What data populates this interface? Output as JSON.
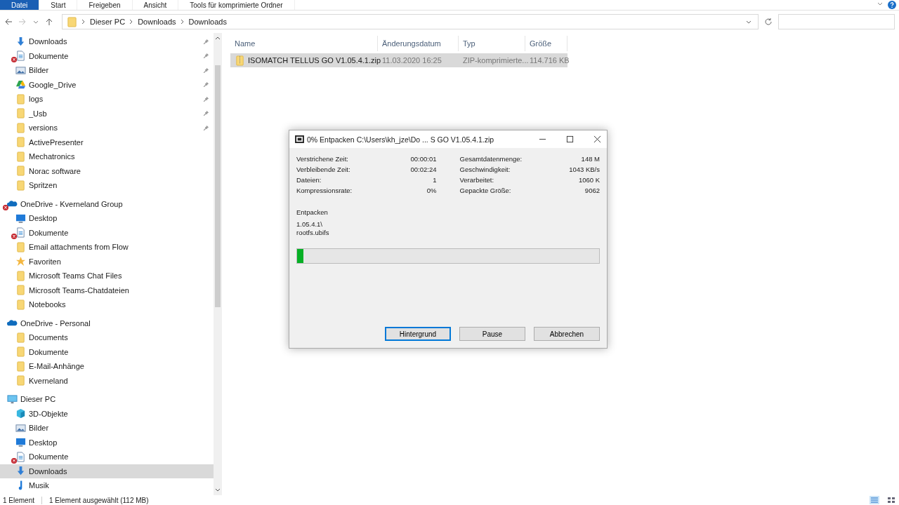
{
  "ribbon": {
    "tabs": [
      {
        "label": "Datei",
        "selected": true
      },
      {
        "label": "Start",
        "selected": false
      },
      {
        "label": "Freigeben",
        "selected": false
      },
      {
        "label": "Ansicht",
        "selected": false
      },
      {
        "label": "Tools für komprimierte Ordner",
        "selected": false
      }
    ]
  },
  "address_bar": {
    "path": [
      "Dieser PC",
      "Downloads",
      "Downloads"
    ]
  },
  "navigation": [
    {
      "label": "Downloads",
      "kind": "download",
      "pinned": true,
      "error": false,
      "selected": false
    },
    {
      "label": "Dokumente",
      "kind": "document",
      "pinned": true,
      "error": true,
      "selected": false
    },
    {
      "label": "Bilder",
      "kind": "picture",
      "pinned": true,
      "error": false,
      "selected": false
    },
    {
      "label": "Google_Drive",
      "kind": "drive",
      "pinned": true,
      "error": false,
      "selected": false
    },
    {
      "label": "logs",
      "kind": "folder",
      "pinned": true,
      "error": false,
      "selected": false
    },
    {
      "label": "_Usb",
      "kind": "folder",
      "pinned": true,
      "error": false,
      "selected": false
    },
    {
      "label": "versions",
      "kind": "folder",
      "pinned": true,
      "error": false,
      "selected": false
    },
    {
      "label": "ActivePresenter",
      "kind": "folder",
      "pinned": false,
      "error": false,
      "selected": false
    },
    {
      "label": "Mechatronics",
      "kind": "folder",
      "pinned": false,
      "error": false,
      "selected": false
    },
    {
      "label": "Norac software",
      "kind": "folder",
      "pinned": false,
      "error": false,
      "selected": false
    },
    {
      "label": "Spritzen",
      "kind": "folder",
      "pinned": false,
      "error": false,
      "selected": false
    },
    {
      "label": "OneDrive - Kverneland Group",
      "kind": "cloud",
      "pinned": false,
      "error": true,
      "selected": false,
      "children": [
        {
          "label": "Desktop",
          "kind": "desktop",
          "pinned": false,
          "error": false,
          "selected": false
        },
        {
          "label": "Dokumente",
          "kind": "document",
          "pinned": false,
          "error": true,
          "selected": false
        },
        {
          "label": "Email attachments from Flow",
          "kind": "folder",
          "pinned": false,
          "error": false,
          "selected": false
        },
        {
          "label": "Favoriten",
          "kind": "star",
          "pinned": false,
          "error": false,
          "selected": false
        },
        {
          "label": "Microsoft Teams Chat Files",
          "kind": "folder",
          "pinned": false,
          "error": false,
          "selected": false
        },
        {
          "label": "Microsoft Teams-Chatdateien",
          "kind": "folder",
          "pinned": false,
          "error": false,
          "selected": false
        },
        {
          "label": "Notebooks",
          "kind": "folder",
          "pinned": false,
          "error": false,
          "selected": false
        }
      ]
    },
    {
      "label": "OneDrive - Personal",
      "kind": "cloud",
      "pinned": false,
      "error": false,
      "selected": false,
      "children": [
        {
          "label": "Documents",
          "kind": "folder",
          "pinned": false,
          "error": false,
          "selected": false
        },
        {
          "label": "Dokumente",
          "kind": "folder",
          "pinned": false,
          "error": false,
          "selected": false
        },
        {
          "label": "E-Mail-Anhänge",
          "kind": "folder",
          "pinned": false,
          "error": false,
          "selected": false
        },
        {
          "label": "Kverneland",
          "kind": "folder",
          "pinned": false,
          "error": false,
          "selected": false
        }
      ]
    },
    {
      "label": "Dieser PC",
      "kind": "pc",
      "pinned": false,
      "error": false,
      "selected": false,
      "children": [
        {
          "label": "3D-Objekte",
          "kind": "cube",
          "pinned": false,
          "error": false,
          "selected": false
        },
        {
          "label": "Bilder",
          "kind": "picture",
          "pinned": false,
          "error": false,
          "selected": false
        },
        {
          "label": "Desktop",
          "kind": "desktop",
          "pinned": false,
          "error": false,
          "selected": false
        },
        {
          "label": "Dokumente",
          "kind": "document",
          "pinned": false,
          "error": true,
          "selected": false
        },
        {
          "label": "Downloads",
          "kind": "download",
          "pinned": false,
          "error": false,
          "selected": true
        },
        {
          "label": "Musik",
          "kind": "music",
          "pinned": false,
          "error": false,
          "selected": false
        }
      ]
    }
  ],
  "file_list": {
    "columns": [
      "Name",
      "Änderungsdatum",
      "Typ",
      "Größe"
    ],
    "rows": [
      {
        "name": "ISOMATCH TELLUS GO V1.05.4.1.zip",
        "date": "11.03.2020 16:25",
        "type": "ZIP-komprimierte...",
        "size": "114.716 KB",
        "selected": true
      }
    ]
  },
  "status_bar": {
    "count": "1 Element",
    "selection": "1 Element ausgewählt (112 MB)"
  },
  "dialog": {
    "title": "0% Entpacken C:\\Users\\kh_jze\\Do ... S GO V1.05.4.1.zip",
    "left_stats": [
      {
        "label": "Verstrichene Zeit:",
        "value": "00:00:01"
      },
      {
        "label": "Verbleibende Zeit:",
        "value": "00:02:24"
      },
      {
        "label": "Dateien:",
        "value": "1"
      },
      {
        "label": "Kompressionsrate:",
        "value": "0%"
      }
    ],
    "right_stats": [
      {
        "label": "Gesamtdatenmenge:",
        "value": "148 M"
      },
      {
        "label": "Geschwindigkeit:",
        "value": "1043 KB/s"
      },
      {
        "label": "Verarbeitet:",
        "value": "1060 K"
      },
      {
        "label": "Gepackte Größe:",
        "value": "9062"
      }
    ],
    "operation": "Entpacken",
    "current_path": "1.05.4.1\\",
    "current_file": "rootfs.ubifs",
    "progress": {
      "level": 0.02
    },
    "buttons": [
      {
        "label": "Hintergrund",
        "selected": true
      },
      {
        "label": "Pause",
        "selected": false
      },
      {
        "label": "Abbrechen",
        "selected": false
      }
    ]
  }
}
